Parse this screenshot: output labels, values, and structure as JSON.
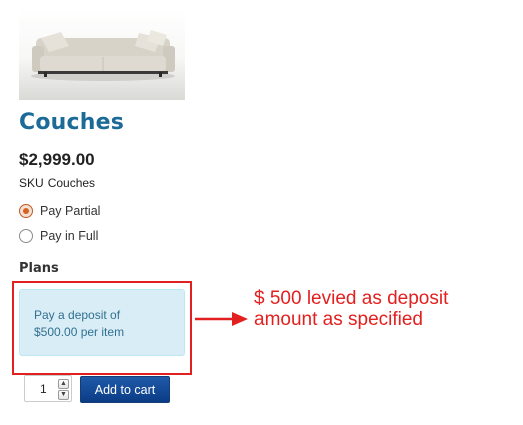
{
  "product": {
    "title": "Couches",
    "price": "$2,999.00",
    "sku_label": "SKU",
    "sku_value": "Couches",
    "image_icon": "couch-image"
  },
  "payment_options": [
    {
      "label": "Pay Partial",
      "checked": true
    },
    {
      "label": "Pay in Full",
      "checked": false
    }
  ],
  "plans": {
    "heading": "Plans",
    "message_line1": "Pay a deposit of",
    "message_line2": "$500.00 per item"
  },
  "annotation": {
    "line1": "$ 500 levied as deposit",
    "line2": "amount as specified",
    "color": "#e32020"
  },
  "cart": {
    "quantity": "1",
    "button_label": "Add to cart"
  },
  "colors": {
    "title": "#1b6a97",
    "radio_accent": "#d8621f",
    "plan_box_bg": "#d9edf7",
    "plan_box_text": "#31708f",
    "button": "#0b3c86"
  }
}
